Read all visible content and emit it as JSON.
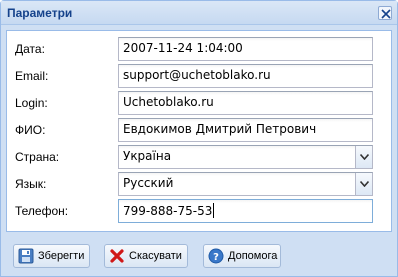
{
  "window": {
    "title": "Параметри",
    "close_icon": "close-icon"
  },
  "form": {
    "fields": [
      {
        "label": "Дата:",
        "value": "2007-11-24 1:04:00",
        "type": "text"
      },
      {
        "label": "Email:",
        "value": "support@uchetoblako.ru",
        "type": "text"
      },
      {
        "label": "Login:",
        "value": "Uchetoblako.ru",
        "type": "text"
      },
      {
        "label": "ФИО:",
        "value": "Евдокимов Дмитрий Петрович",
        "type": "text"
      },
      {
        "label": "Страна:",
        "value": "Україна",
        "type": "combo"
      },
      {
        "label": "Язык:",
        "value": "Русский",
        "type": "combo"
      },
      {
        "label": "Телефон:",
        "value": "799-888-75-53",
        "type": "text"
      }
    ]
  },
  "buttons": {
    "save": {
      "label": "Зберегти",
      "icon": "save-disk-icon"
    },
    "cancel": {
      "label": "Скасувати",
      "icon": "red-x-icon"
    },
    "help": {
      "label": "Допомога",
      "icon": "help-question-icon"
    }
  },
  "colors": {
    "title_text": "#15428b",
    "window_bg": "#cfdff3",
    "border": "#99bbe8"
  }
}
